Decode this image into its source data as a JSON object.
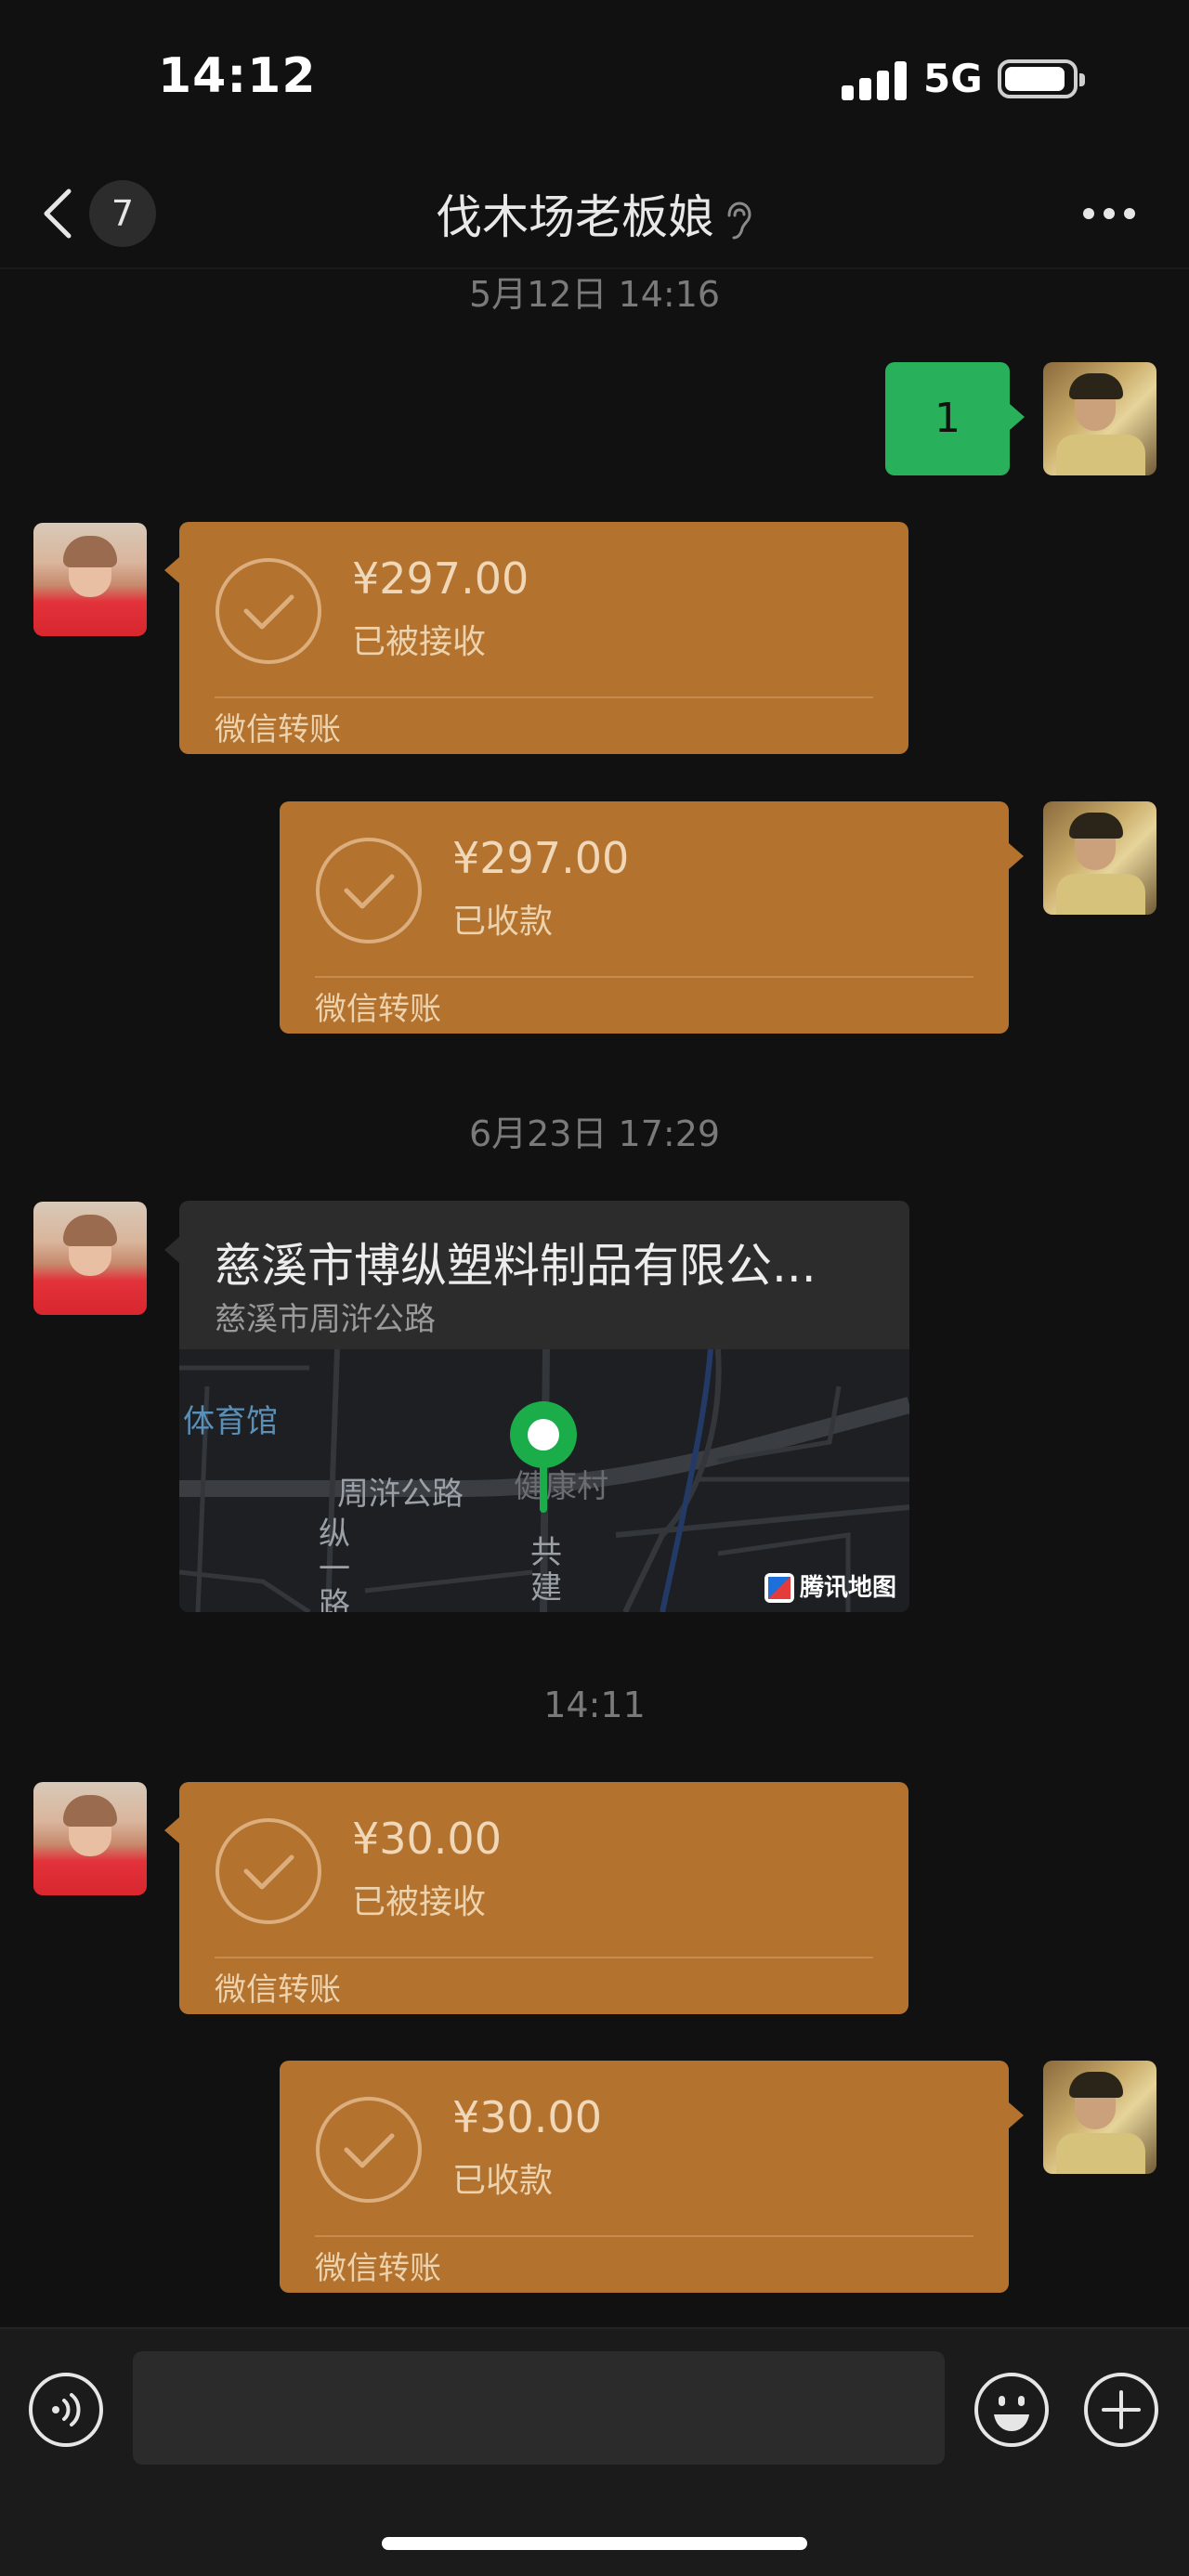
{
  "status_bar": {
    "time": "14:12",
    "network": "5G"
  },
  "nav": {
    "unread_count": "7",
    "title": "伐木场老板娘"
  },
  "messages": {
    "timestamp_1": "5月12日 14:16",
    "text_msg": "1",
    "transfer_1": {
      "amount": "¥297.00",
      "status": "已被接收",
      "footer": "微信转账"
    },
    "transfer_2": {
      "amount": "¥297.00",
      "status": "已收款",
      "footer": "微信转账"
    },
    "timestamp_2": "6月23日 17:29",
    "location": {
      "title": "慈溪市博纵塑料制品有限公...",
      "subtitle": "慈溪市周浒公路",
      "map_labels": {
        "poi": "体育馆",
        "road1": "周浒公路",
        "village": "健康村",
        "road2": "纵一路",
        "road3": "共建"
      },
      "provider": "腾讯地图"
    },
    "timestamp_3": "14:11",
    "transfer_3": {
      "amount": "¥30.00",
      "status": "已被接收",
      "footer": "微信转账"
    },
    "transfer_4": {
      "amount": "¥30.00",
      "status": "已收款",
      "footer": "微信转账"
    }
  },
  "input_bar": {
    "placeholder": ""
  },
  "icons": {
    "back": "chevron-left-icon",
    "ear": "ear-icon",
    "more": "more-icon",
    "check": "check-circle-icon",
    "voice": "voice-icon",
    "emoji": "emoji-icon",
    "plus": "plus-icon",
    "pin": "map-pin-icon"
  },
  "colors": {
    "background": "#111111",
    "transfer": "#b3722e",
    "sent_bubble": "#29b05a",
    "map_pin": "#1aad4a"
  }
}
